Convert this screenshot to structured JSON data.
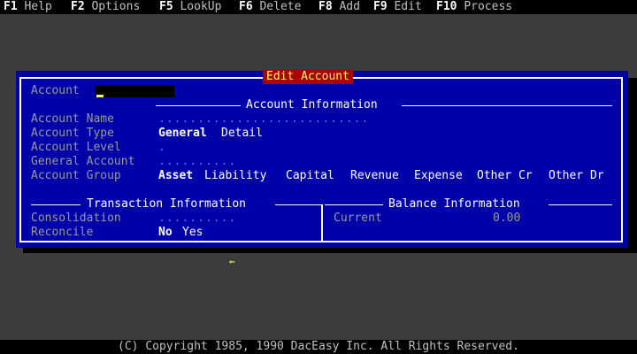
{
  "menu": [
    {
      "key": "F1",
      "label": "Help"
    },
    {
      "key": "F2",
      "label": "Options"
    },
    {
      "key": "F5",
      "label": "LookUp"
    },
    {
      "key": "F6",
      "label": "Delete"
    },
    {
      "key": "F8",
      "label": "Add"
    },
    {
      "key": "F9",
      "label": "Edit"
    },
    {
      "key": "F10",
      "label": "Process"
    }
  ],
  "dialog": {
    "title": "Edit Account",
    "account_label": "Account",
    "account_value": "",
    "sections": {
      "account_info": "Account Information",
      "transaction_info": "Transaction Information",
      "balance_info": "Balance Information"
    },
    "fields": {
      "account_name": "Account Name",
      "account_type": "Account Type",
      "account_level": "Account Level",
      "general_account": "General Account",
      "account_group": "Account Group",
      "consolidation": "Consolidation",
      "reconcile": "Reconcile",
      "current": "Current"
    },
    "account_type_options": [
      "General",
      "Detail"
    ],
    "account_group_options": [
      "Asset",
      "Liability",
      "Capital",
      "Revenue",
      "Expense",
      "Other Cr",
      "Other Dr"
    ],
    "reconcile_options": [
      "No",
      "Yes"
    ],
    "current_balance": "0.00",
    "placeholders": {
      "account_name": "...........................",
      "account_level": ".",
      "general_account": "..........",
      "consolidation": ".........."
    }
  },
  "footer": "(C) Copyright 1985, 1990 DacEasy Inc. All Rights Reserved.",
  "colors": {
    "dialog_bg": "#0000a8",
    "title_bg": "#a80000",
    "title_fg": "#ffff55"
  }
}
